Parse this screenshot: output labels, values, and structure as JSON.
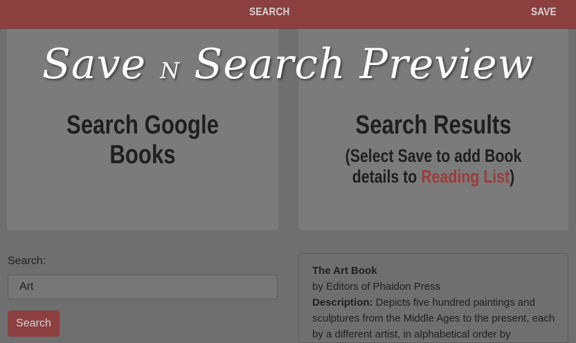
{
  "nav": {
    "search_label": "SEARCH",
    "save_label": "SAVE"
  },
  "overlay": {
    "title_part1": "Save",
    "title_part2": "N",
    "title_part3": "Search Preview"
  },
  "panels": {
    "left_heading": "Search Google Books",
    "right_heading": "Search Results",
    "right_sub_line1": "(Select Save to add Book",
    "right_sub_line2_prefix": "details to ",
    "right_sub_link": "Reading List",
    "right_sub_line2_suffix": ")"
  },
  "search": {
    "label": "Search:",
    "value": "Art",
    "button_label": "Search"
  },
  "result": {
    "title": "The Art Book",
    "author": "by Editors of Phaidon Press",
    "description_label": "Description:",
    "description": " Depicts five hundred paintings and sculptures from the Middle Ages to the present, each by a different artist, in alphabetical order by"
  },
  "colors": {
    "navbar": "#8c3f3f",
    "link": "#9b3b3b"
  }
}
